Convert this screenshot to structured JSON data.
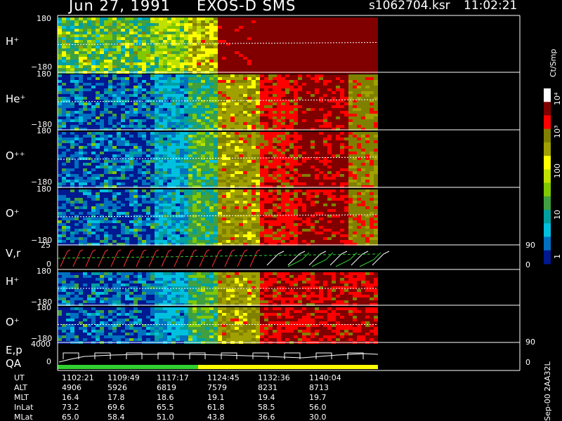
{
  "header": {
    "date": "Jun 27, 1991",
    "instrument": "EXOS-D SMS",
    "file": "s1062704.ksr",
    "time": "11:02:21"
  },
  "colorbar": {
    "unit_label": "Ct/Smp",
    "ticks": [
      "10⁴",
      "10³",
      "100",
      "10",
      "1"
    ],
    "colors": [
      "#ffffff",
      "#800000",
      "#ff0000",
      "#808000",
      "#a0a000",
      "#ffff00",
      "#c0e000",
      "#80c800",
      "#40a040",
      "#00a0a0",
      "#00c0e0",
      "#0070c0",
      "#001890"
    ]
  },
  "version_label": "Sep-00 2AA32L",
  "panels": [
    {
      "id": "h_plus",
      "label": "H⁺",
      "top_tick": "180",
      "bottom_tick": "−180"
    },
    {
      "id": "he_plus",
      "label": "He⁺",
      "top_tick": "180",
      "bottom_tick": "−180"
    },
    {
      "id": "o_pp",
      "label": "O⁺⁺",
      "top_tick": "180",
      "bottom_tick": "−180"
    },
    {
      "id": "o_plus",
      "label": "O⁺",
      "top_tick": "180",
      "bottom_tick": "−180"
    },
    {
      "id": "vr",
      "label": "V,r",
      "top_tick": "25",
      "bottom_tick": "0",
      "right_top": "90",
      "right_bottom": "0"
    },
    {
      "id": "h_plus_2",
      "label": "H⁺",
      "top_tick": "180",
      "bottom_tick": "−180"
    },
    {
      "id": "o_plus_2",
      "label": "O⁺",
      "top_tick": "180",
      "bottom_tick": "−180"
    },
    {
      "id": "ep",
      "label": "E,p",
      "label2": "QA",
      "top_tick": "4000",
      "bottom_tick": "0",
      "right_top": "90",
      "right_bottom": "0"
    }
  ],
  "time_table": {
    "rows": [
      {
        "name": "UT",
        "values": [
          "1102:21",
          "1109:49",
          "1117:17",
          "1124:45",
          "1132:36",
          "1140:04"
        ]
      },
      {
        "name": "ALT",
        "values": [
          "4906",
          "5926",
          "6819",
          "7579",
          "8231",
          "8713"
        ]
      },
      {
        "name": "MLT",
        "values": [
          "16.4",
          "17.8",
          "18.6",
          "19.1",
          "19.4",
          "19.7"
        ]
      },
      {
        "name": "InLat",
        "values": [
          "73.2",
          "69.6",
          "65.5",
          "61.8",
          "58.5",
          "56.0"
        ]
      },
      {
        "name": "MLat",
        "values": [
          "65.0",
          "58.4",
          "51.0",
          "43.8",
          "36.6",
          "30.0"
        ]
      }
    ]
  },
  "chart_data": {
    "type": "heatmap",
    "title": "Jun 27, 1991 EXOS-D SMS",
    "x_label": "UT",
    "x_ticks": [
      "1102:21",
      "1109:49",
      "1117:17",
      "1124:45",
      "1132:36",
      "1140:04"
    ],
    "y_range": [
      -180,
      180
    ],
    "color_scale": "log",
    "color_range": [
      1,
      10000
    ],
    "series": [
      {
        "name": "H⁺"
      },
      {
        "name": "He⁺"
      },
      {
        "name": "O⁺⁺"
      },
      {
        "name": "O⁺"
      },
      {
        "name": "V,r",
        "y_range": [
          0,
          25
        ],
        "right_range": [
          0,
          90
        ]
      },
      {
        "name": "H⁺"
      },
      {
        "name": "O⁺"
      },
      {
        "name": "E,p",
        "y_range": [
          0,
          4000
        ],
        "right_range": [
          0,
          90
        ]
      }
    ]
  }
}
